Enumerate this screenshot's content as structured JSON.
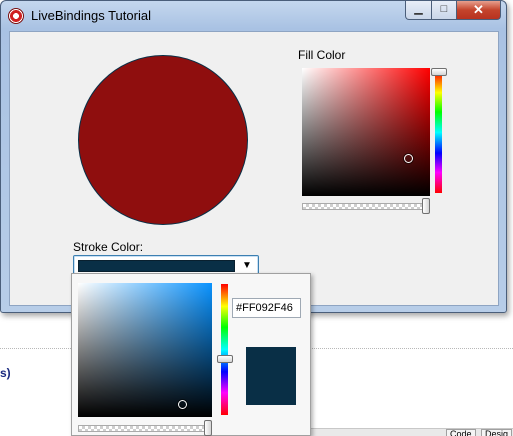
{
  "window": {
    "title": "LiveBindings Tutorial",
    "minimize_glyph": "▁",
    "maximize_glyph": "□",
    "close_glyph": "✕"
  },
  "circle": {
    "fill_color": "#8F0E0E",
    "stroke_color": "#092F46"
  },
  "fill_picker": {
    "label": "Fill Color",
    "hue_color": "#FF0000",
    "hue_level": 0.0,
    "alpha_level": 1.0
  },
  "stroke_picker": {
    "label": "Stroke Color:",
    "selected_color": "#092F46",
    "dropdown_arrow": "▼",
    "hex_value": "#FF092F46",
    "hue_color": "#0A93FF",
    "hue_level": 0.57,
    "alpha_level": 1.0
  },
  "background": {
    "fragment_text": "s)",
    "tabs": [
      "Code",
      "Desig"
    ]
  },
  "icons": {
    "app": "app-logo-icon",
    "minimize": "minimize-icon",
    "maximize": "maximize-icon",
    "close": "close-icon",
    "dropdown": "chevron-down-icon"
  }
}
